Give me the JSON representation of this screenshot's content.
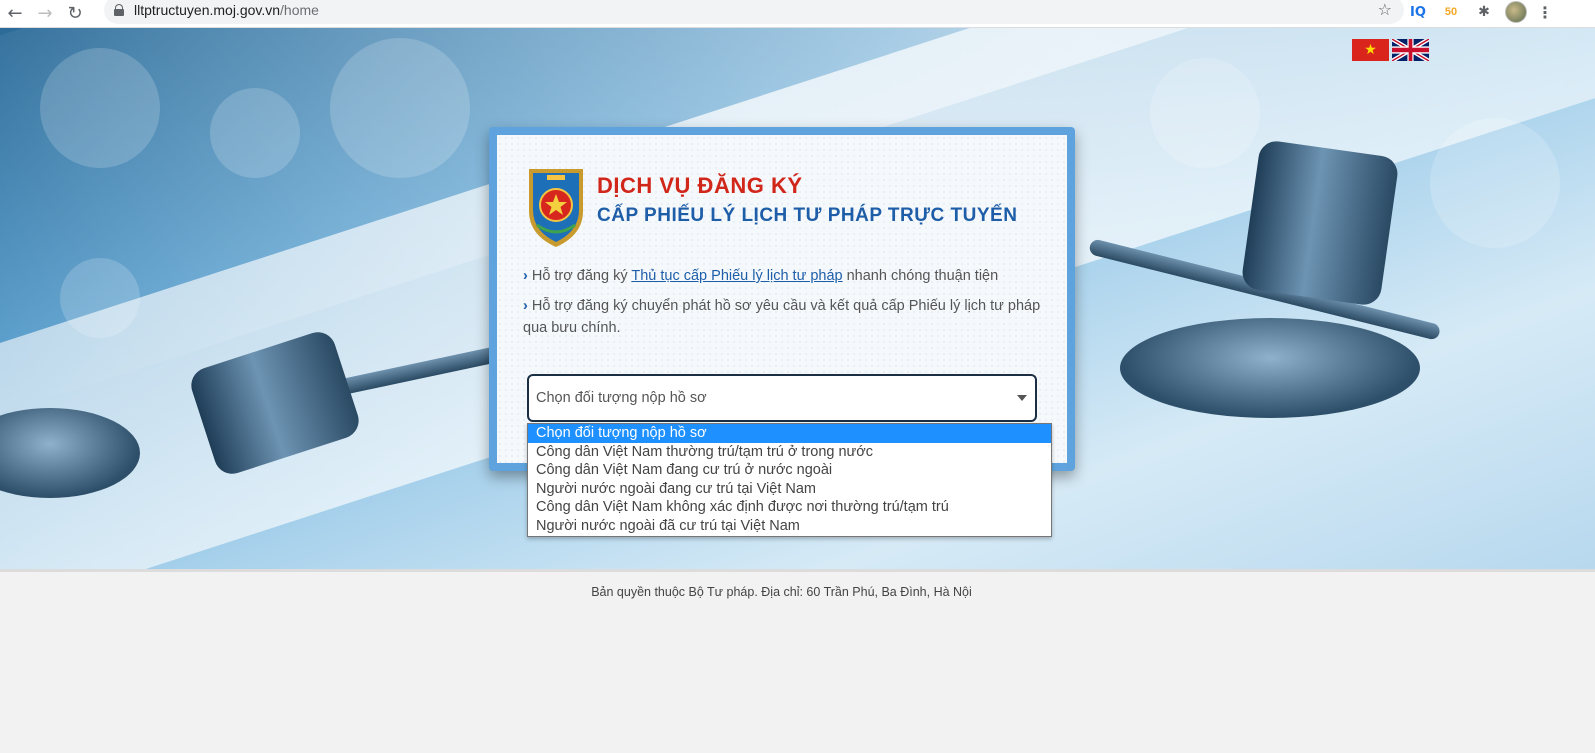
{
  "browser": {
    "url_host": "lltptructuyen.moj.gov.vn",
    "url_path": "/home",
    "extensions": [
      "IQ",
      "50"
    ]
  },
  "hero": {
    "flags": [
      "vietnam-flag",
      "uk-flag"
    ]
  },
  "card": {
    "title_line1": "DỊCH VỤ ĐĂNG KÝ",
    "title_line2": "CẤP PHIẾU LÝ LỊCH TƯ PHÁP TRỰC TUYẾN",
    "bullet1_prefix": "Hỗ trợ đăng ký ",
    "bullet1_link": "Thủ tục cấp Phiếu lý lịch tư pháp",
    "bullet1_suffix": " nhanh chóng thuận tiện",
    "bullet2": "Hỗ trợ đăng ký chuyển phát hồ sơ yêu cầu và kết quả cấp Phiếu lý lịch tư pháp qua bưu chính.",
    "select_value": "Chọn đối tượng nộp hồ sơ"
  },
  "dropdown": {
    "options": [
      "Chọn đối tượng nộp hồ sơ",
      "Công dân Việt Nam thường trú/tạm trú ở trong nước",
      "Công dân Việt Nam đang cư trú ở nước ngoài",
      "Người nước ngoài đang cư trú tại Việt Nam",
      "Công dân Việt Nam không xác định được nơi thường trú/tạm trú",
      "Người nước ngoài đã cư trú tại Việt Nam"
    ],
    "selected_index": 0
  },
  "footer": {
    "text": "Bản quyền thuộc Bộ Tư pháp. Địa chỉ: 60 Trần Phú, Ba Đình, Hà Nội"
  },
  "colors": {
    "title_red": "#d1261a",
    "title_blue": "#1e5ea8",
    "card_border": "#5ea3dd",
    "option_selected": "#1e90ff"
  }
}
